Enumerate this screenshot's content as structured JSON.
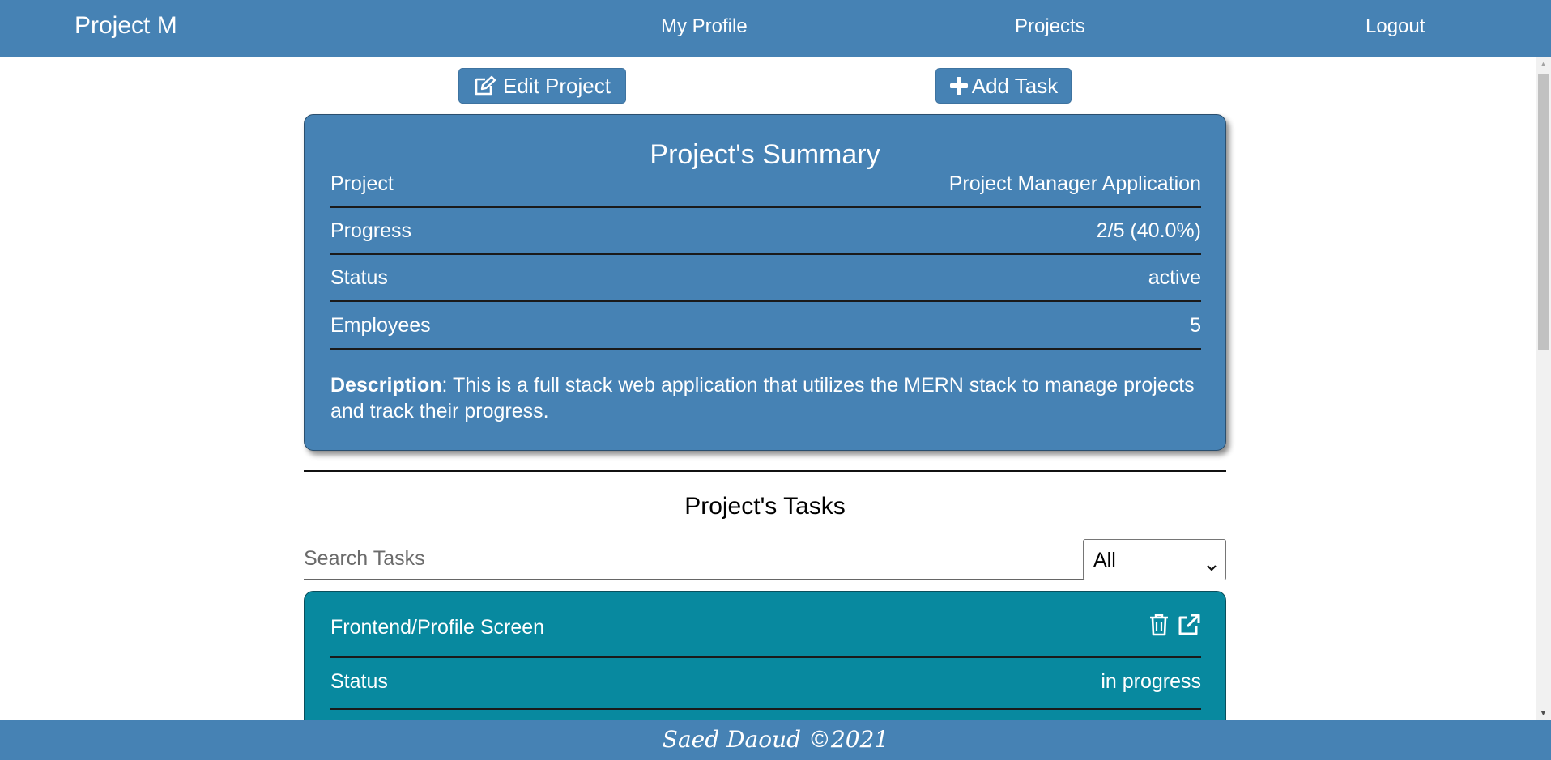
{
  "navbar": {
    "brand": "Project M",
    "links": [
      "My Profile",
      "Projects",
      "Logout"
    ]
  },
  "actions": {
    "edit_project": "Edit Project",
    "add_task": "Add Task"
  },
  "summary": {
    "title": "Project's Summary",
    "rows": [
      {
        "label": "Project",
        "value": "Project Manager Application"
      },
      {
        "label": "Progress",
        "value": "2/5 (40.0%)"
      },
      {
        "label": "Status",
        "value": "active"
      },
      {
        "label": "Employees",
        "value": "5"
      }
    ],
    "description_label": "Description",
    "description_text": ": This is a full stack web application that utilizes the MERN stack to manage projects and track their progress."
  },
  "tasks": {
    "heading": "Project's Tasks",
    "search_placeholder": "Search Tasks",
    "filter_value": "All",
    "items": [
      {
        "title": "Frontend/Profile Screen",
        "status_label": "Status",
        "status_value": "in progress"
      }
    ]
  },
  "footer": {
    "text": "Saed Daoud ©2021"
  },
  "icons": {
    "edit": "edit-icon",
    "add": "plus-icon",
    "delete": "trash-icon",
    "open": "external-link-icon",
    "select": "chevron-down-icon"
  },
  "colors": {
    "primary": "#4682b4",
    "task_card": "#08899f",
    "text_on_primary": "#ffffff"
  }
}
